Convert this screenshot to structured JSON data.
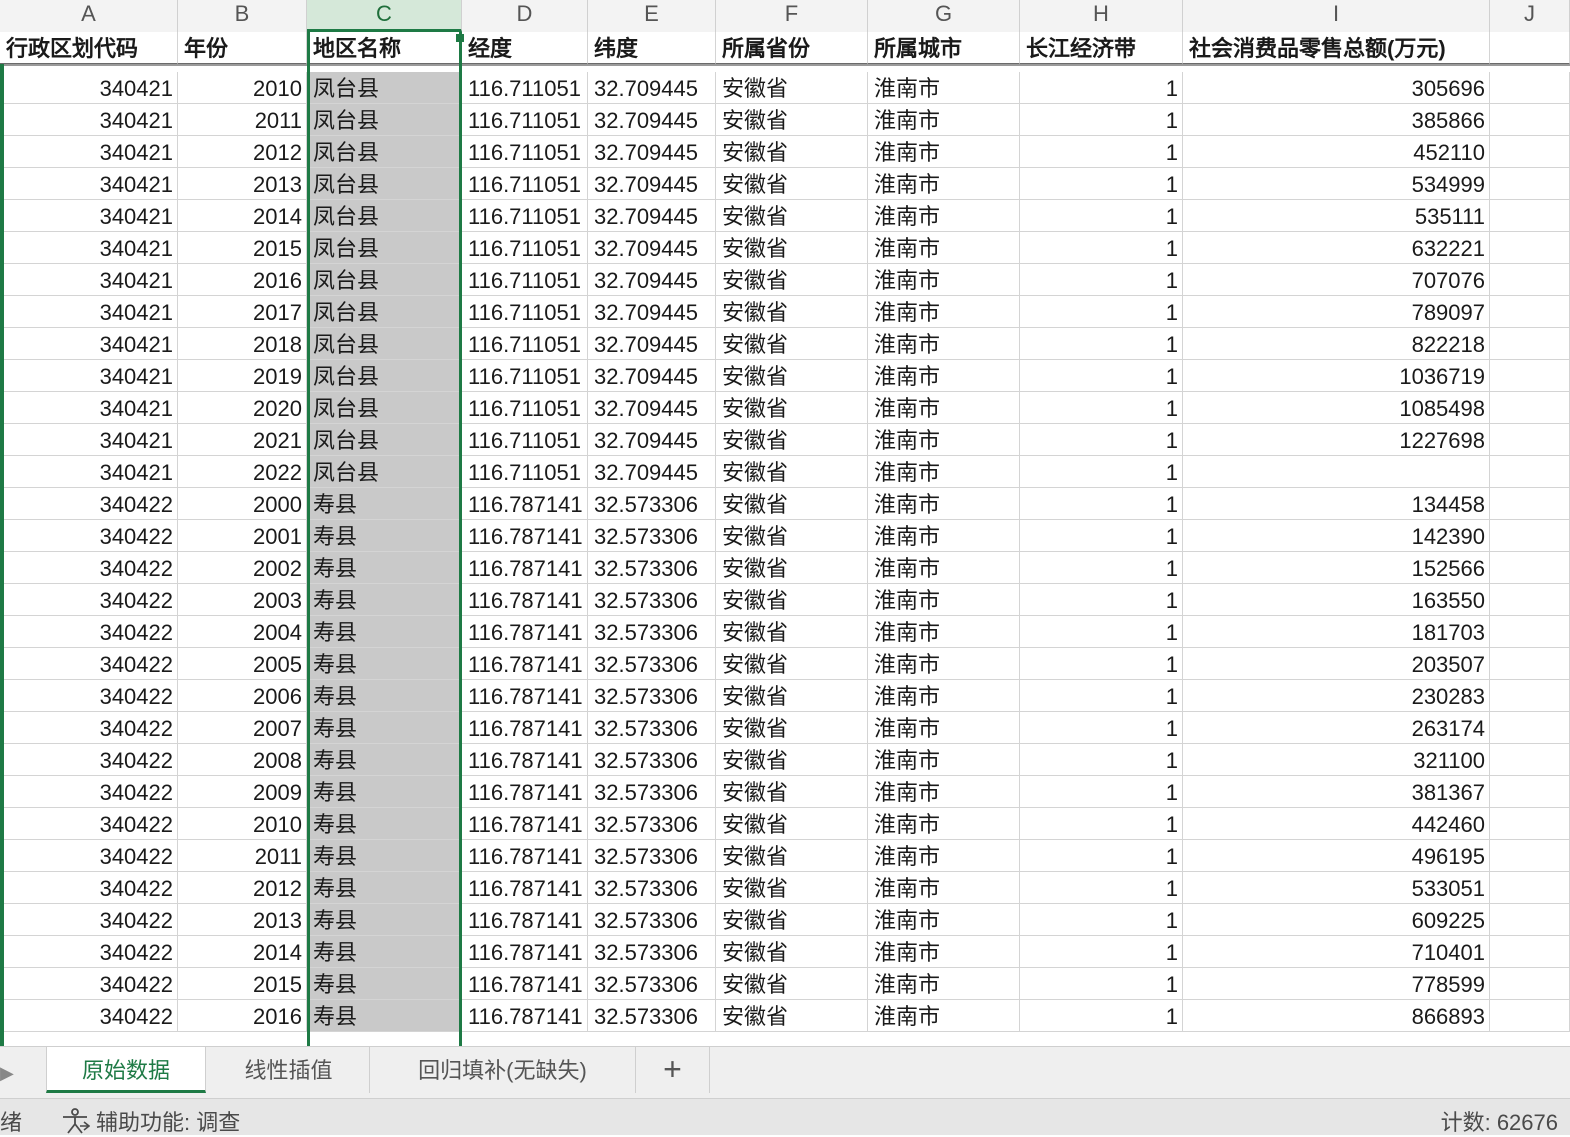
{
  "columns": [
    "A",
    "B",
    "C",
    "D",
    "E",
    "F",
    "G",
    "H",
    "I",
    "J"
  ],
  "selected_column": "C",
  "header": [
    "行政区划代码",
    "年份",
    "地区名称",
    "经度",
    "纬度",
    "所属省份",
    "所属城市",
    "长江经济带",
    "社会消费品零售总额(万元)"
  ],
  "rows": [
    [
      "340421",
      "2010",
      "凤台县",
      "116.711051",
      "32.709445",
      "安徽省",
      "淮南市",
      "1",
      "305696"
    ],
    [
      "340421",
      "2011",
      "凤台县",
      "116.711051",
      "32.709445",
      "安徽省",
      "淮南市",
      "1",
      "385866"
    ],
    [
      "340421",
      "2012",
      "凤台县",
      "116.711051",
      "32.709445",
      "安徽省",
      "淮南市",
      "1",
      "452110"
    ],
    [
      "340421",
      "2013",
      "凤台县",
      "116.711051",
      "32.709445",
      "安徽省",
      "淮南市",
      "1",
      "534999"
    ],
    [
      "340421",
      "2014",
      "凤台县",
      "116.711051",
      "32.709445",
      "安徽省",
      "淮南市",
      "1",
      "535111"
    ],
    [
      "340421",
      "2015",
      "凤台县",
      "116.711051",
      "32.709445",
      "安徽省",
      "淮南市",
      "1",
      "632221"
    ],
    [
      "340421",
      "2016",
      "凤台县",
      "116.711051",
      "32.709445",
      "安徽省",
      "淮南市",
      "1",
      "707076"
    ],
    [
      "340421",
      "2017",
      "凤台县",
      "116.711051",
      "32.709445",
      "安徽省",
      "淮南市",
      "1",
      "789097"
    ],
    [
      "340421",
      "2018",
      "凤台县",
      "116.711051",
      "32.709445",
      "安徽省",
      "淮南市",
      "1",
      "822218"
    ],
    [
      "340421",
      "2019",
      "凤台县",
      "116.711051",
      "32.709445",
      "安徽省",
      "淮南市",
      "1",
      "1036719"
    ],
    [
      "340421",
      "2020",
      "凤台县",
      "116.711051",
      "32.709445",
      "安徽省",
      "淮南市",
      "1",
      "1085498"
    ],
    [
      "340421",
      "2021",
      "凤台县",
      "116.711051",
      "32.709445",
      "安徽省",
      "淮南市",
      "1",
      "1227698"
    ],
    [
      "340421",
      "2022",
      "凤台县",
      "116.711051",
      "32.709445",
      "安徽省",
      "淮南市",
      "1",
      ""
    ],
    [
      "340422",
      "2000",
      "寿县",
      "116.787141",
      "32.573306",
      "安徽省",
      "淮南市",
      "1",
      "134458"
    ],
    [
      "340422",
      "2001",
      "寿县",
      "116.787141",
      "32.573306",
      "安徽省",
      "淮南市",
      "1",
      "142390"
    ],
    [
      "340422",
      "2002",
      "寿县",
      "116.787141",
      "32.573306",
      "安徽省",
      "淮南市",
      "1",
      "152566"
    ],
    [
      "340422",
      "2003",
      "寿县",
      "116.787141",
      "32.573306",
      "安徽省",
      "淮南市",
      "1",
      "163550"
    ],
    [
      "340422",
      "2004",
      "寿县",
      "116.787141",
      "32.573306",
      "安徽省",
      "淮南市",
      "1",
      "181703"
    ],
    [
      "340422",
      "2005",
      "寿县",
      "116.787141",
      "32.573306",
      "安徽省",
      "淮南市",
      "1",
      "203507"
    ],
    [
      "340422",
      "2006",
      "寿县",
      "116.787141",
      "32.573306",
      "安徽省",
      "淮南市",
      "1",
      "230283"
    ],
    [
      "340422",
      "2007",
      "寿县",
      "116.787141",
      "32.573306",
      "安徽省",
      "淮南市",
      "1",
      "263174"
    ],
    [
      "340422",
      "2008",
      "寿县",
      "116.787141",
      "32.573306",
      "安徽省",
      "淮南市",
      "1",
      "321100"
    ],
    [
      "340422",
      "2009",
      "寿县",
      "116.787141",
      "32.573306",
      "安徽省",
      "淮南市",
      "1",
      "381367"
    ],
    [
      "340422",
      "2010",
      "寿县",
      "116.787141",
      "32.573306",
      "安徽省",
      "淮南市",
      "1",
      "442460"
    ],
    [
      "340422",
      "2011",
      "寿县",
      "116.787141",
      "32.573306",
      "安徽省",
      "淮南市",
      "1",
      "496195"
    ],
    [
      "340422",
      "2012",
      "寿县",
      "116.787141",
      "32.573306",
      "安徽省",
      "淮南市",
      "1",
      "533051"
    ],
    [
      "340422",
      "2013",
      "寿县",
      "116.787141",
      "32.573306",
      "安徽省",
      "淮南市",
      "1",
      "609225"
    ],
    [
      "340422",
      "2014",
      "寿县",
      "116.787141",
      "32.573306",
      "安徽省",
      "淮南市",
      "1",
      "710401"
    ],
    [
      "340422",
      "2015",
      "寿县",
      "116.787141",
      "32.573306",
      "安徽省",
      "淮南市",
      "1",
      "778599"
    ],
    [
      "340422",
      "2016",
      "寿县",
      "116.787141",
      "32.573306",
      "安徽省",
      "淮南市",
      "1",
      "866893"
    ]
  ],
  "sheet_tabs": [
    "原始数据",
    "线性插值",
    "回归填补(无缺失)"
  ],
  "active_tab": 0,
  "add_sheet_label": "+",
  "status": {
    "ready": "绪",
    "accessibility": "辅助功能: 调查",
    "count": "计数: 62676"
  },
  "colors": {
    "accent": "#1e7a45",
    "selected_fill": "#c9c9c9"
  },
  "icons": {
    "accessibility": "accessibility-icon",
    "tab_nav": "triangle-right-icon"
  }
}
